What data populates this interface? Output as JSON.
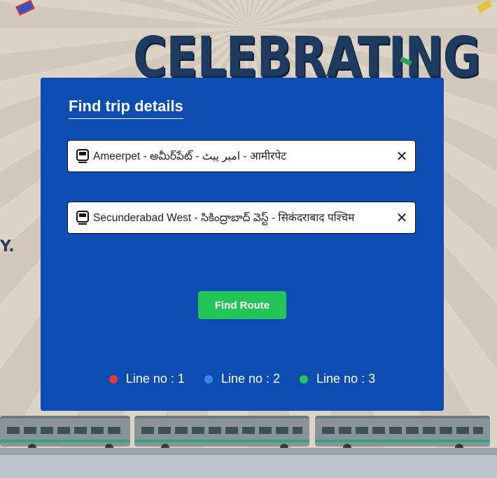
{
  "background": {
    "banner_text": "CELEBRATING",
    "side_text": "Y."
  },
  "form": {
    "title": "Find trip details",
    "from_station": "Ameerpet - అమీర్‌పేట్ - امیر پیٹ - आमीरपेट",
    "to_station": "Secunderabad West - సికింద్రాబాద్ వెస్ట్ - सिकंदराबाद पश्चिम",
    "clear_glyph": "✕",
    "submit_label": "Find Route"
  },
  "legend": [
    {
      "label": "Line no : 1",
      "color": "#e23b3b"
    },
    {
      "label": "Line no : 2",
      "color": "#3b82f6"
    },
    {
      "label": "Line no : 3",
      "color": "#22c55e"
    }
  ],
  "colors": {
    "panel": "#0d4db1",
    "button": "#23c45a"
  },
  "icons": [
    "train-icon",
    "close-icon"
  ]
}
